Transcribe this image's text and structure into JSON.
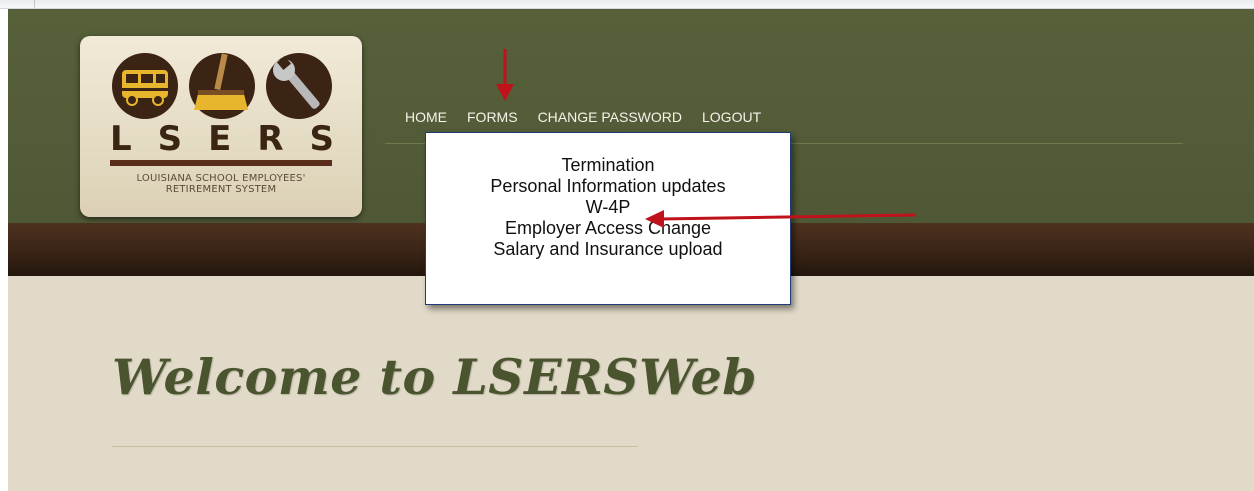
{
  "logo": {
    "letters": [
      "L",
      "S",
      "E",
      "R",
      "S"
    ],
    "subtitle_line1": "LOUISIANA SCHOOL EMPLOYEES'",
    "subtitle_line2": "RETIREMENT SYSTEM"
  },
  "nav": {
    "items": [
      {
        "label": "HOME"
      },
      {
        "label": "FORMS"
      },
      {
        "label": "CHANGE PASSWORD"
      },
      {
        "label": "LOGOUT"
      }
    ]
  },
  "forms_menu": {
    "items": [
      {
        "label": "Termination"
      },
      {
        "label": "Personal Information updates"
      },
      {
        "label": "W-4P"
      },
      {
        "label": "Employer Access Change"
      },
      {
        "label": "Salary and Insurance upload"
      }
    ]
  },
  "main": {
    "welcome": "Welcome to LSERSWeb"
  },
  "colors": {
    "header_green": "#566039",
    "band_brown": "#3a2416",
    "content_beige": "#e2dac8",
    "annotation_red": "#c0121b"
  },
  "icons": [
    "bus-icon",
    "broom-icon",
    "wrench-icon",
    "annotation-arrow-icon"
  ]
}
